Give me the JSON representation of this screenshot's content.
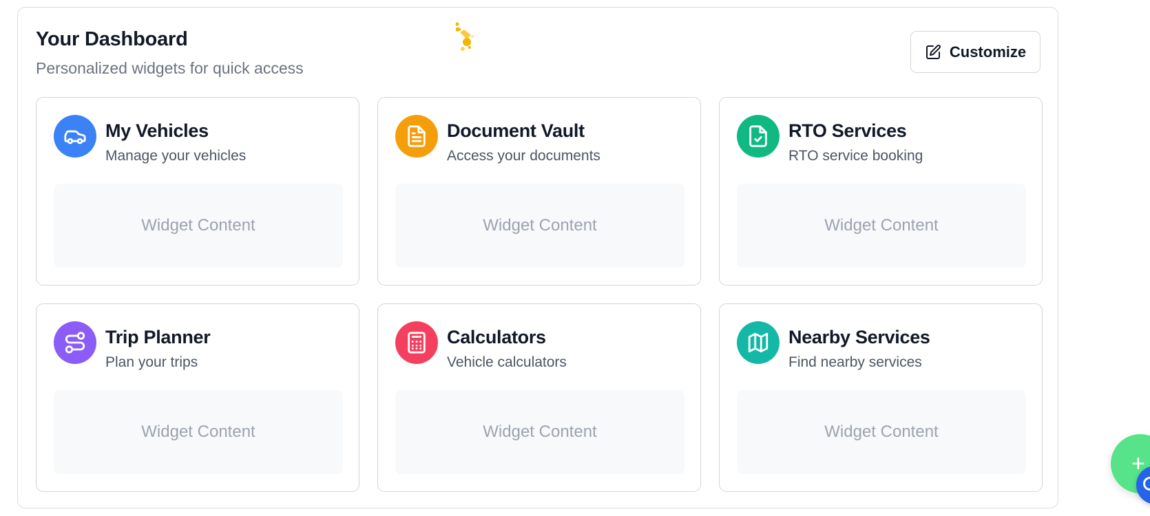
{
  "dashboard": {
    "title": "Your Dashboard",
    "subtitle": "Personalized widgets for quick access",
    "customize_label": "Customize"
  },
  "widgets": [
    {
      "title": "My Vehicles",
      "subtitle": "Manage your vehicles",
      "content": "Widget Content",
      "icon": "car-icon",
      "color": "#3b82f6"
    },
    {
      "title": "Document Vault",
      "subtitle": "Access your documents",
      "content": "Widget Content",
      "icon": "document-icon",
      "color": "#f59e0b"
    },
    {
      "title": "RTO Services",
      "subtitle": "RTO service booking",
      "content": "Widget Content",
      "icon": "file-check-icon",
      "color": "#10b981"
    },
    {
      "title": "Trip Planner",
      "subtitle": "Plan your trips",
      "content": "Widget Content",
      "icon": "route-icon",
      "color": "#8b5cf6"
    },
    {
      "title": "Calculators",
      "subtitle": "Vehicle calculators",
      "content": "Widget Content",
      "icon": "calculator-icon",
      "color": "#f43f5e"
    },
    {
      "title": "Nearby Services",
      "subtitle": "Find nearby services",
      "content": "Widget Content",
      "icon": "map-icon",
      "color": "#14b8a6"
    }
  ],
  "fab": {
    "label": "+",
    "color": "#57e389",
    "secondary_color": "#2563eb"
  }
}
